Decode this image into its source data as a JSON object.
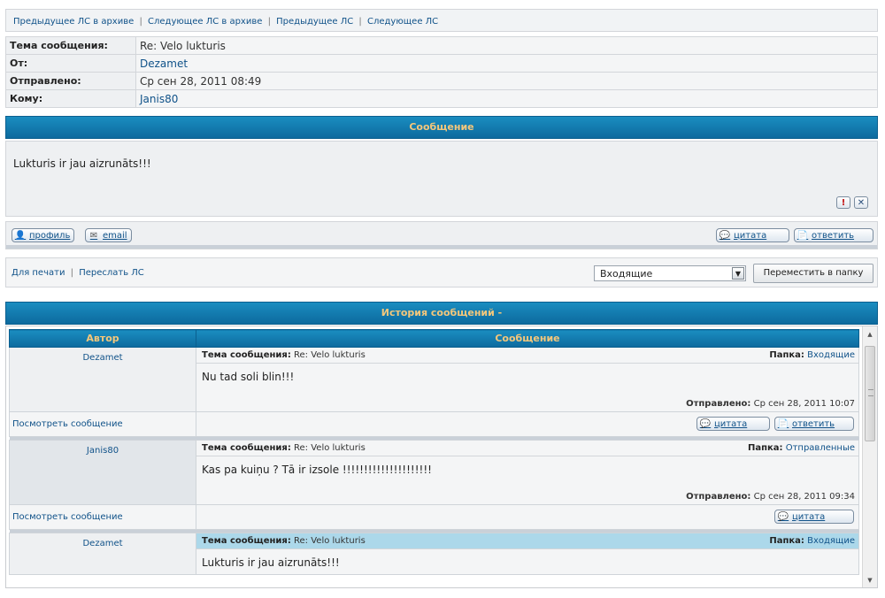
{
  "nav": {
    "prev_archive": "Предыдущее ЛС в архиве",
    "next_archive": "Следующее ЛС в архиве",
    "prev": "Предыдущее ЛС",
    "next": "Следующее ЛС",
    "separator": "|"
  },
  "header": {
    "subject_label": "Тема сообщения:",
    "subject_value": "Re: Velo lukturis",
    "from_label": "От:",
    "from_value": "Dezamet",
    "sent_label": "Отправлено:",
    "sent_value": "Ср сен 28, 2011 08:49",
    "to_label": "Кому:",
    "to_value": "Janis80"
  },
  "message": {
    "heading": "Сообщение",
    "body": "Lukturis ir jau aizrunāts!!!",
    "report_icon": "!",
    "delete_icon": "✕",
    "profile_label": "профиль",
    "email_label": "email",
    "quote_label": "цитата",
    "reply_label": "ответить"
  },
  "actions": {
    "print_label": "Для печати",
    "forward_label": "Переслать ЛС",
    "separator": "|",
    "folder_selected": "Входящие",
    "move_button": "Переместить в папку"
  },
  "history": {
    "heading": "История сообщений -",
    "col_author": "Автор",
    "col_message": "Сообщение",
    "subject_label": "Тема сообщения:",
    "folder_label": "Папка:",
    "sent_label": "Отправлено:",
    "view_label": "Посмотреть сообщение",
    "quote_label": "цитата",
    "reply_label": "ответить",
    "items": [
      {
        "author": "Dezamet",
        "subject": "Re: Velo lukturis",
        "folder": "Входящие",
        "body": "Nu tad soli blin!!!",
        "sent": "Ср сен 28, 2011 10:07"
      },
      {
        "author": "Janis80",
        "subject": "Re: Velo lukturis",
        "folder": "Отправленные",
        "body": "Kas pa kuiņu ? Tā ir izsole !!!!!!!!!!!!!!!!!!!!!",
        "sent": "Ср сен 28, 2011 09:34"
      },
      {
        "author": "Dezamet",
        "subject": "Re: Velo lukturis",
        "folder": "Входящие",
        "body": "Lukturis ir jau aizrunāts!!!"
      }
    ]
  },
  "colors": {
    "header_gradient_top": "#1a8dc0",
    "header_gradient_bottom": "#0d6a9e",
    "header_text": "#f5c77b",
    "link": "#105289",
    "highlight_row": "#acd8ea"
  }
}
